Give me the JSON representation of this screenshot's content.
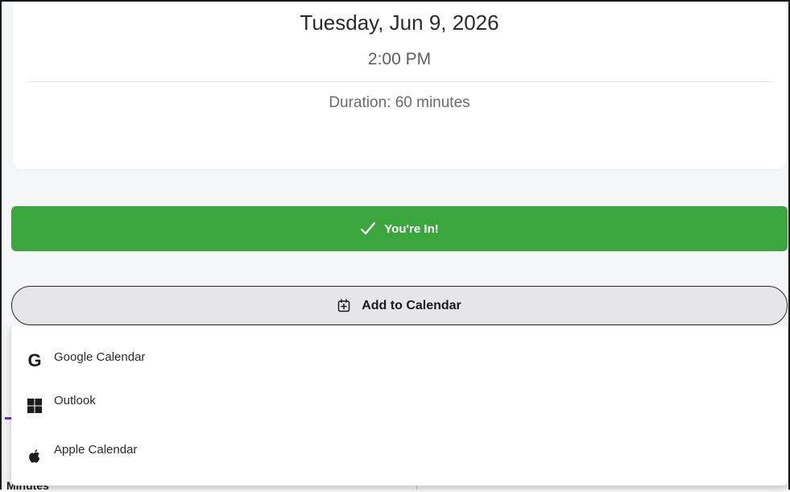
{
  "event": {
    "date": "Tuesday, Jun 9, 2026",
    "time": "2:00 PM",
    "duration": "Duration: 60 minutes"
  },
  "confirm": {
    "label": "You're In!",
    "color": "#3aa63d"
  },
  "add_to_calendar": {
    "label": "Add to Calendar",
    "icon": "calendar-plus-icon"
  },
  "calendar_options": [
    {
      "label": "Google Calendar",
      "icon": "google-icon"
    },
    {
      "label": "Outlook",
      "icon": "windows-icon"
    },
    {
      "label": "Apple Calendar",
      "icon": "apple-icon"
    }
  ],
  "background": {
    "partial_text": "Minutes"
  }
}
